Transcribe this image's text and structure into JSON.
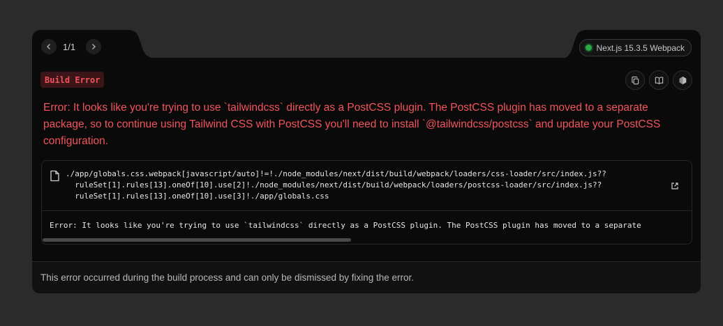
{
  "header": {
    "pager": "1/1",
    "version": "Next.js 15.3.5 Webpack"
  },
  "badge": "Build Error",
  "message": "Error: It looks like you're trying to use `tailwindcss` directly as a PostCSS plugin. The PostCSS plugin has moved to a separate package, so to continue using Tailwind CSS with PostCSS you'll need to install `@tailwindcss/postcss` and update your PostCSS configuration.",
  "code": {
    "file_path": "./app/globals.css.webpack[javascript/auto]!=!./node_modules/next/dist/build/webpack/loaders/css-loader/src/index.js??\n  ruleSet[1].rules[13].oneOf[10].use[2]!./node_modules/next/dist/build/webpack/loaders/postcss-loader/src/index.js??\n  ruleSet[1].rules[13].oneOf[10].use[3]!./app/globals.css",
    "stack_line": "Error: It looks like you're trying to use `tailwindcss` directly as a PostCSS plugin. The PostCSS plugin has moved to a separate"
  },
  "footer": "This error occurred during the build process and can only be dismissed by fixing the error.",
  "icons": {
    "prev": "chevron-left-icon",
    "next": "chevron-right-icon",
    "copy": "copy-icon",
    "docs": "book-icon",
    "nodejs": "hexagon-icon",
    "file": "file-icon",
    "external": "external-link-icon"
  },
  "colors": {
    "error": "#f2545b",
    "status_ok": "#2aa84a",
    "surface": "#0a0a0a"
  }
}
